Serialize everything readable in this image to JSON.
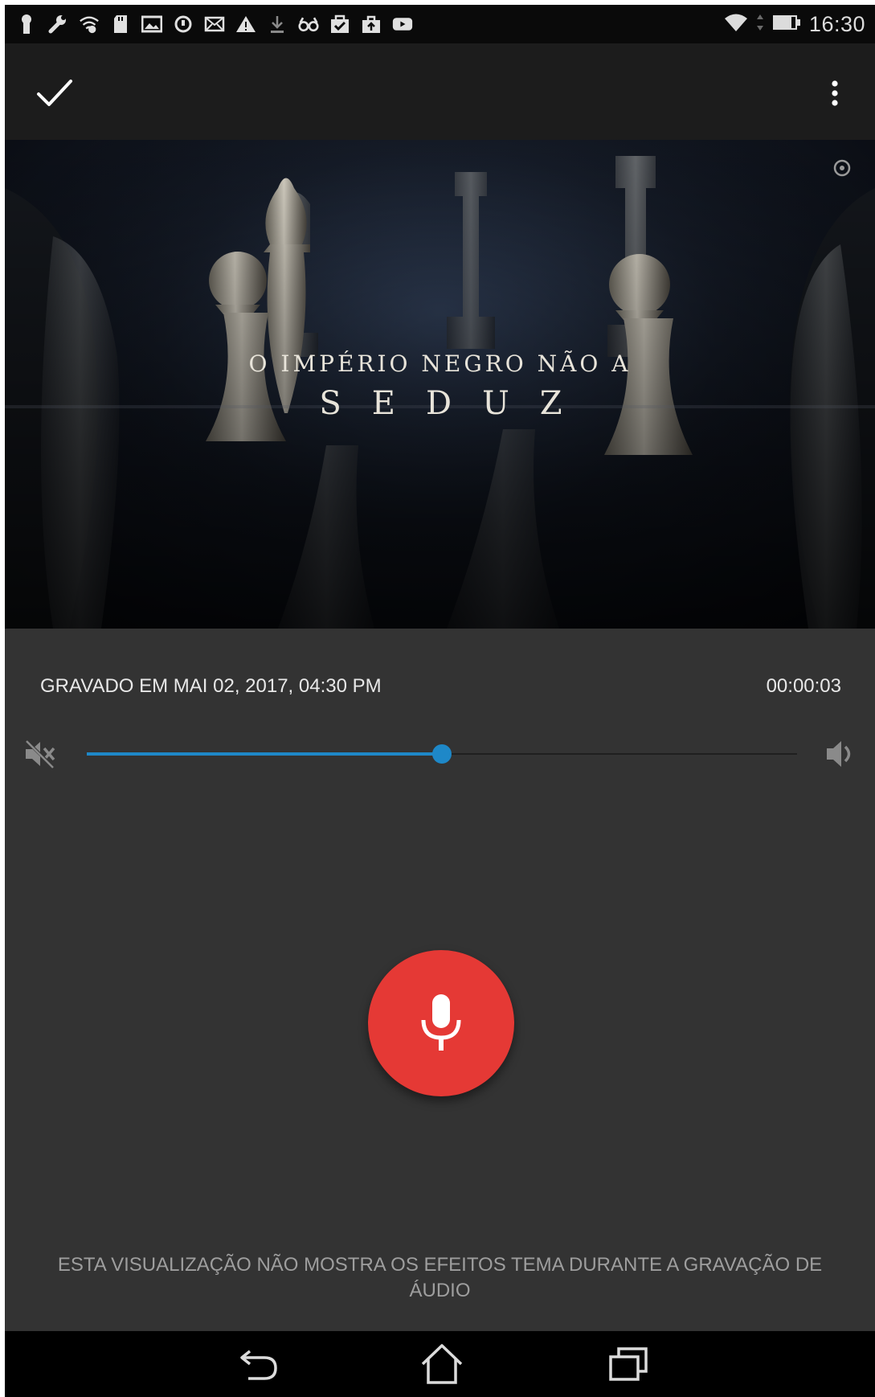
{
  "status_bar": {
    "time": "16:30",
    "left_icons": [
      "keyhole-icon",
      "wrench-icon",
      "wifi-lock-icon",
      "sd-card-icon",
      "image-icon",
      "sync-icon",
      "mail-icon",
      "warning-icon",
      "download-icon",
      "glasses-icon",
      "clipboard-check-icon",
      "briefcase-upload-icon",
      "youtube-icon"
    ],
    "right_icons": [
      "wifi-icon",
      "data-arrows-icon",
      "battery-icon"
    ]
  },
  "app_bar": {
    "done_icon": "check-icon",
    "menu_icon": "more-vert-icon"
  },
  "video": {
    "caption_line1": "O IMPÉRIO NEGRO NÃO A",
    "caption_line2": "SEDUZ",
    "corner_icon": "rotate-icon"
  },
  "recording": {
    "recorded_label": "GRAVADO EM MAI 02, 2017, 04:30 PM",
    "duration": "00:00:03"
  },
  "volume": {
    "level": 0.5,
    "min_icon": "volume-mute-icon",
    "max_icon": "volume-up-icon",
    "accent_color": "#1e88c8"
  },
  "mic_button": {
    "icon": "microphone-icon",
    "color": "#e53935"
  },
  "notice": "ESTA VISUALIZAÇÃO NÃO MOSTRA OS EFEITOS TEMA DURANTE A GRAVAÇÃO DE ÁUDIO",
  "nav_bar": {
    "back_icon": "back-icon",
    "home_icon": "home-icon",
    "recents_icon": "recents-icon"
  }
}
